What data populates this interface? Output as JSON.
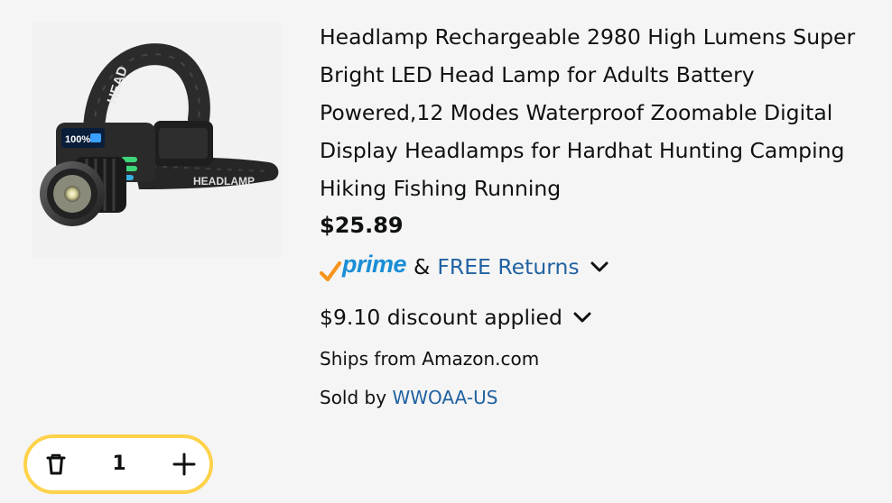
{
  "product": {
    "image_alt": "Headlamp product photo",
    "title": "Headlamp Rechargeable 2980 High Lumens Super Bright LED Head Lamp for Adults Battery Powered,12 Modes Waterproof Zoomable Digital Display Headlamps for Hardhat Hunting Camping Hiking Fishing Running",
    "price": "$25.89",
    "image_text": {
      "strap_text": "HEAD",
      "band_text": "HEADLAMP",
      "display_text": "100%"
    }
  },
  "delivery": {
    "prime_label": "prime",
    "ampersand": "&",
    "returns_label": "FREE Returns"
  },
  "discount": {
    "label": "$9.10 discount applied"
  },
  "shipping": {
    "ships_from": "Ships from Amazon.com",
    "sold_by_prefix": "Sold by",
    "seller": "WWOAA-US"
  },
  "quantity": {
    "value": "1"
  },
  "colors": {
    "background": "#f5f5f5",
    "link": "#2162a1",
    "prime_blue": "#1a8ed6",
    "prime_check": "#f7941d",
    "stepper_border": "#fed24a",
    "text": "#0f1111"
  },
  "icons": {
    "prime_check": "checkmark-icon",
    "returns_chevron": "chevron-down-icon",
    "discount_chevron": "chevron-down-icon",
    "delete": "trash-icon",
    "increment": "plus-icon"
  }
}
